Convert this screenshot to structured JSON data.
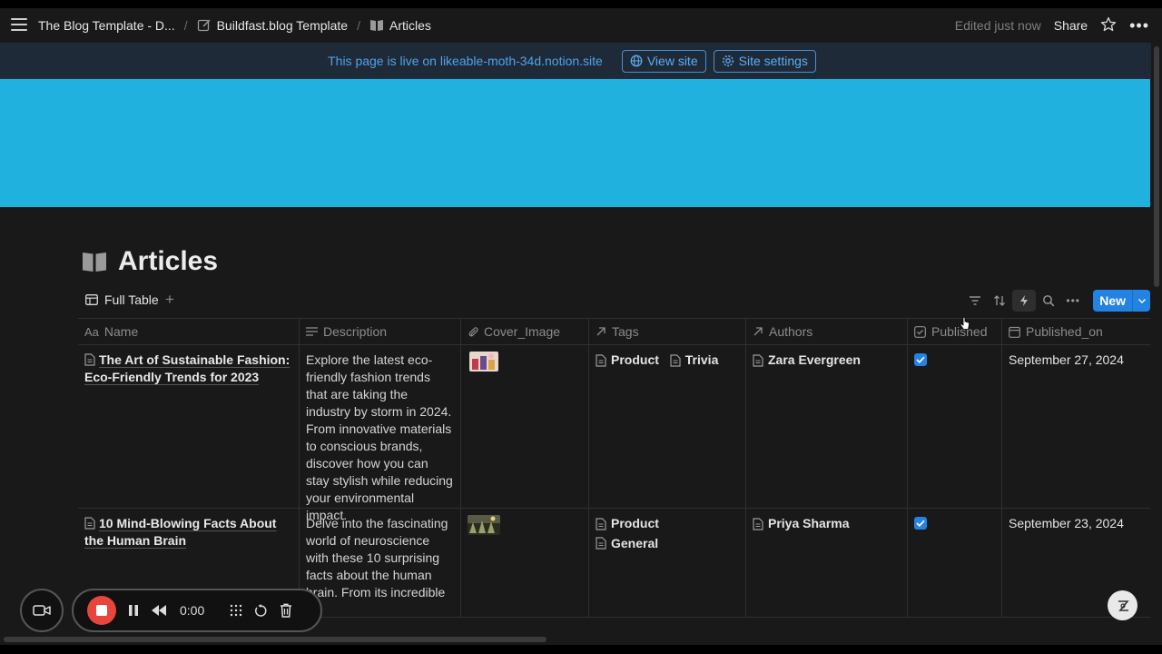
{
  "topbar": {
    "crumbs": [
      "The Blog Template - D...",
      "Buildfast.blog Template",
      "Articles"
    ],
    "edited": "Edited just now",
    "share": "Share"
  },
  "banner": {
    "text": "This page is live on likeable-moth-34d.notion.site",
    "view_site": "View site",
    "site_settings": "Site settings"
  },
  "page": {
    "title": "Articles",
    "view_tab": "Full Table",
    "new_label": "New"
  },
  "table": {
    "columns": [
      "Name",
      "Description",
      "Cover_Image",
      "Tags",
      "Authors",
      "Published",
      "Published_on"
    ],
    "rows": [
      {
        "name": "The Art of Sustainable Fashion: Eco-Friendly Trends for 2023",
        "description": "Explore the latest eco-friendly fashion trends that are taking the industry by storm in 2024. From innovative materials to conscious brands, discover how you can stay stylish while reducing your environmental impact.",
        "tags": [
          "Product",
          "Trivia"
        ],
        "author": "Zara Evergreen",
        "published": true,
        "published_on": "September 27, 2024"
      },
      {
        "name": "10 Mind-Blowing Facts About the Human Brain",
        "description": "Delve into the fascinating world of neuroscience with these 10 surprising facts about the human brain. From its incredible",
        "tags": [
          "Product",
          "General"
        ],
        "author": "Priya Sharma",
        "published": true,
        "published_on": "September 23, 2024"
      }
    ]
  },
  "recorder": {
    "time": "0:00"
  },
  "colors": {
    "accent": "#2383e2",
    "cover": "#21b1df",
    "banner_text": "#4ea3e8",
    "record": "#e8453c"
  }
}
